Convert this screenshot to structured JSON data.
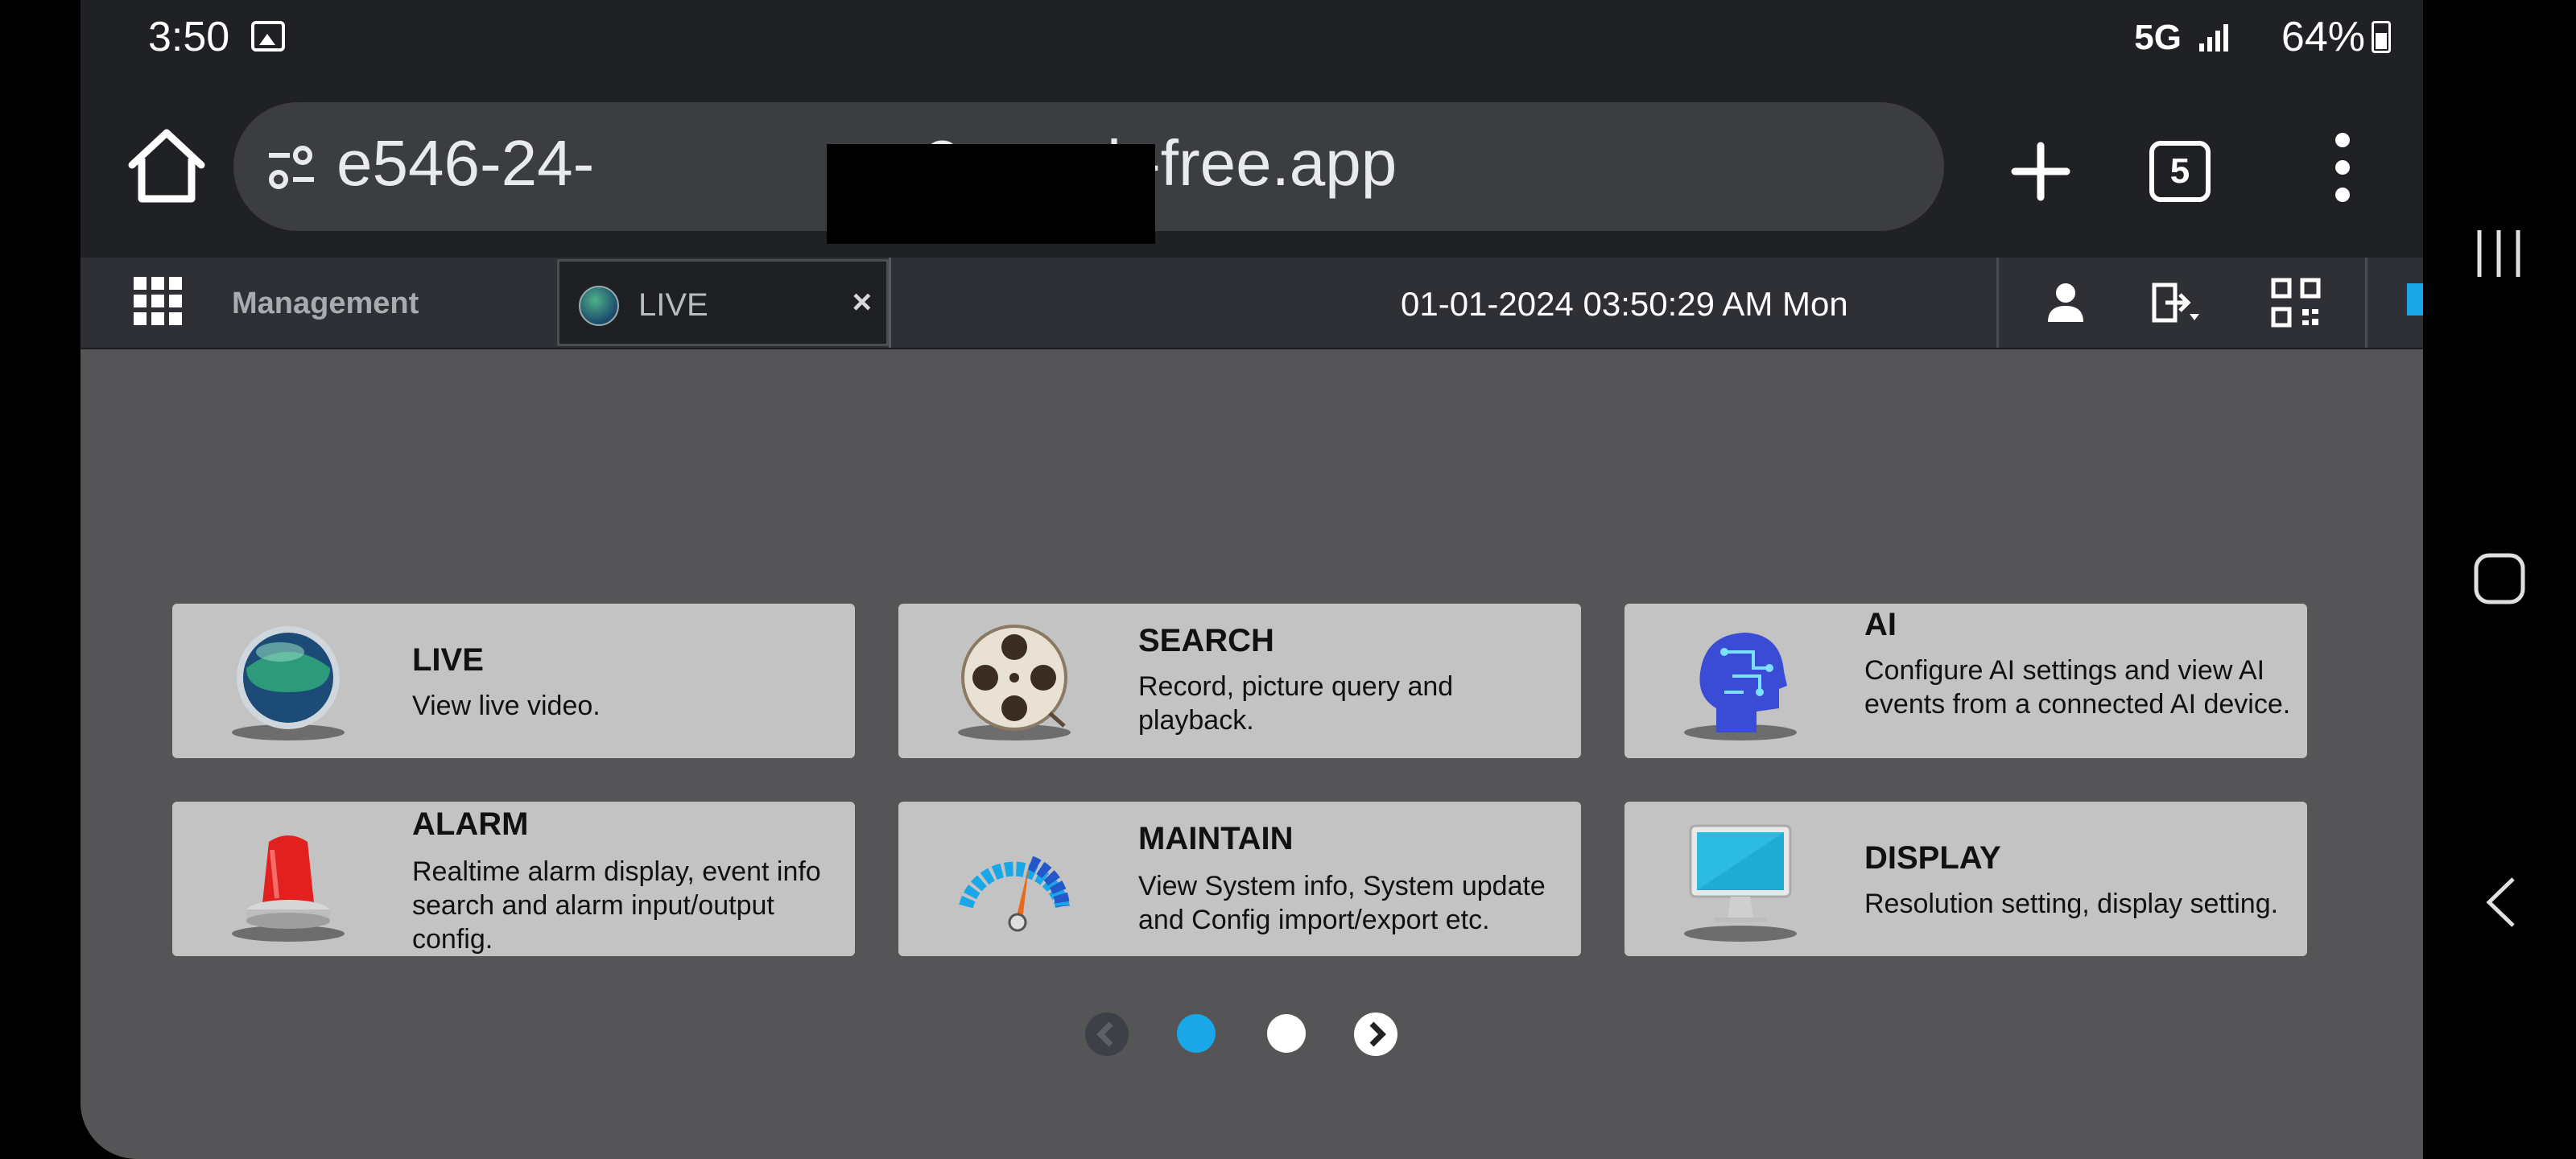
{
  "status_bar": {
    "time": "3:50",
    "network": "5G",
    "battery": "64%"
  },
  "browser": {
    "url_prefix": "e546-24-",
    "url_suffix": "3.ngrok-free.app",
    "tab_count": "5"
  },
  "app": {
    "menu_label": "Management",
    "tab_label": "LIVE",
    "tab_close": "×",
    "datetime": "01-01-2024 03:50:29 AM Mon"
  },
  "modules": [
    {
      "title": "LIVE",
      "desc": "View live video.",
      "icon": "globe-icon"
    },
    {
      "title": "SEARCH",
      "desc": "Record, picture query and playback.",
      "icon": "film-reel-icon"
    },
    {
      "title": "AI",
      "desc": "Configure AI settings and view AI events from a connected AI device.",
      "icon": "ai-head-icon"
    },
    {
      "title": "ALARM",
      "desc": "Realtime alarm display, event info search and alarm input/output config.",
      "icon": "alarm-siren-icon"
    },
    {
      "title": "MAINTAIN",
      "desc": "View System info, System update and Config import/export etc.",
      "icon": "gauge-icon"
    },
    {
      "title": "DISPLAY",
      "desc": "Resolution setting, display setting.",
      "icon": "monitor-icon"
    }
  ],
  "pager": {
    "current_page": 1,
    "total_pages": 2
  },
  "colors": {
    "accent": "#1aa7e8",
    "card_bg": "#c3c3c3",
    "app_bg": "#555557",
    "nav_bg": "#2e3035"
  }
}
